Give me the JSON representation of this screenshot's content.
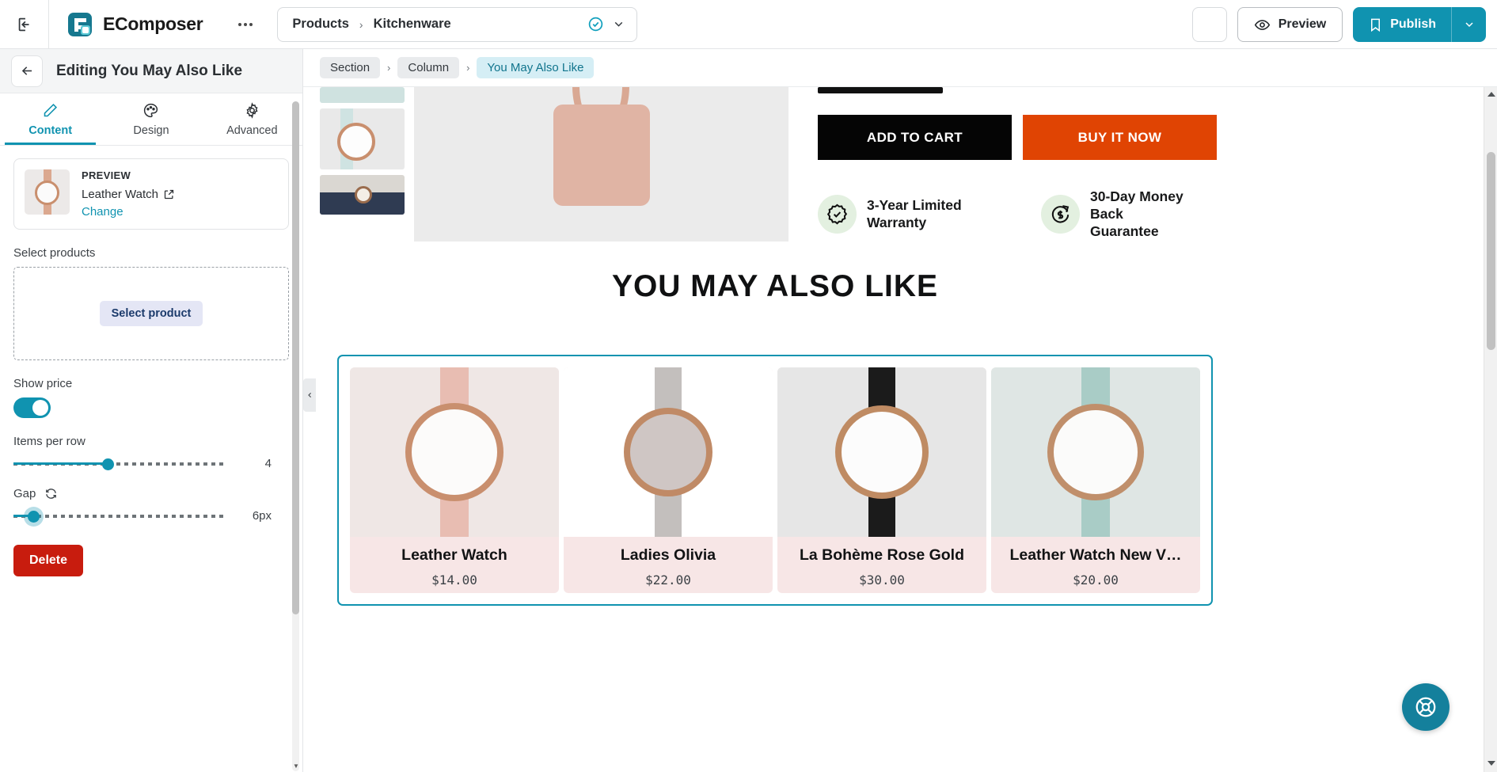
{
  "topbar": {
    "collapse_icon": "collapse-panel-icon",
    "brand_name": "EComposer",
    "more_icon": "more-options-icon",
    "page_picker": {
      "parent": "Products",
      "separator": "›",
      "current": "Kitchenware",
      "status_icon": "check-circle-icon",
      "caret_icon": "chevron-down-icon"
    },
    "blank_button": "",
    "preview_label": "Preview",
    "preview_icon": "eye-icon",
    "publish_label": "Publish",
    "publish_icon": "bookmark-icon",
    "publish_caret_icon": "chevron-down-icon"
  },
  "panel": {
    "back_icon": "arrow-left-icon",
    "title": "Editing You May Also Like",
    "tabs": [
      {
        "label": "Content",
        "icon": "pencil-icon",
        "active": true
      },
      {
        "label": "Design",
        "icon": "palette-icon",
        "active": false
      },
      {
        "label": "Advanced",
        "icon": "gear-icon",
        "active": false
      }
    ],
    "preview": {
      "heading": "PREVIEW",
      "product_name": "Leather Watch",
      "external_icon": "external-link-icon",
      "change_label": "Change"
    },
    "select_products_label": "Select products",
    "select_product_button": "Select product",
    "show_price_label": "Show price",
    "show_price_on": true,
    "items_per_row_label": "Items per row",
    "items_per_row_value": "4",
    "items_per_row_percent": 44,
    "gap_label": "Gap",
    "gap_reset_icon": "refresh-icon",
    "gap_value": "6px",
    "gap_percent": 7,
    "delete_label": "Delete"
  },
  "canvas": {
    "breadcrumb": [
      {
        "label": "Section",
        "active": false
      },
      {
        "label": "Column",
        "active": false
      },
      {
        "label": "You May Also Like",
        "active": true
      }
    ],
    "breadcrumb_sep": "›",
    "cta": {
      "add_to_cart": "ADD TO CART",
      "buy_it_now": "BUY IT NOW"
    },
    "badges": [
      {
        "icon": "seal-check-icon",
        "line1": "3-Year Limited",
        "line2": "Warranty"
      },
      {
        "icon": "money-back-icon",
        "line1": "30-Day Money Back",
        "line2": "Guarantee"
      }
    ],
    "section_title": "YOU MAY ALSO LIKE",
    "products": [
      {
        "title": "Leather Watch",
        "price": "$14.00",
        "strap": "#e8bdb2",
        "band": "#e3b5a9",
        "bg": "#efe7e5"
      },
      {
        "title": "Ladies Olivia",
        "price": "$22.00",
        "strap": "#b8b4b2",
        "band": "#c0bcba",
        "bg": "#ffffff"
      },
      {
        "title": "La Bohème Rose Gold",
        "price": "$30.00",
        "strap": "#1b1b1b",
        "band": "#262626",
        "bg": "#e6e6e6"
      },
      {
        "title": "Leather Watch New V…",
        "price": "$20.00",
        "strap": "#a9ccc6",
        "band": "#b4d4ce",
        "bg": "#dfe6e4"
      }
    ],
    "collapse_handle_icon": "chevron-left-icon",
    "support_icon": "lifebuoy-icon"
  },
  "colors": {
    "accent": "#1093b0",
    "danger": "#c81c0e",
    "buy_now": "#e04403",
    "card_pink": "#f7e6e6"
  }
}
